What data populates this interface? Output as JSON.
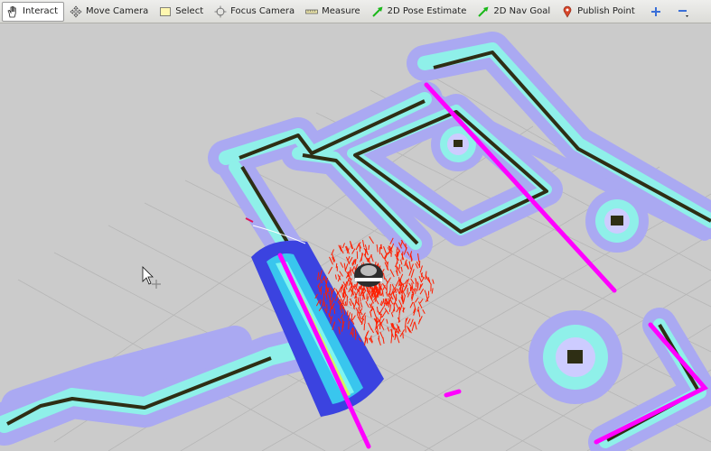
{
  "toolbar": {
    "tools": [
      {
        "label": "Interact",
        "icon": "hand-icon",
        "active": true
      },
      {
        "label": "Move Camera",
        "icon": "move-camera-icon"
      },
      {
        "label": "Select",
        "icon": "select-icon"
      },
      {
        "label": "Focus Camera",
        "icon": "focus-camera-icon"
      },
      {
        "label": "Measure",
        "icon": "measure-icon"
      },
      {
        "label": "2D Pose Estimate",
        "icon": "pose-arrow-icon"
      },
      {
        "label": "2D Nav Goal",
        "icon": "nav-goal-arrow-icon"
      },
      {
        "label": "Publish Point",
        "icon": "map-pin-icon"
      }
    ],
    "add_tool_icon": "plus-icon",
    "remove_tool_icon": "minus-dropdown-icon"
  },
  "viewport": {
    "grid_color": "#b9b9b9",
    "background": "#c8c8c8",
    "map_wall_color": "#2e2e14",
    "inflation_color": "#a9a9f5",
    "inner_inflation_color": "#8ff0e9",
    "laser_scan_color": "#ff00ff",
    "particle_cloud_color": "#ff1e00",
    "local_costmap_color": "#3b43e0"
  }
}
